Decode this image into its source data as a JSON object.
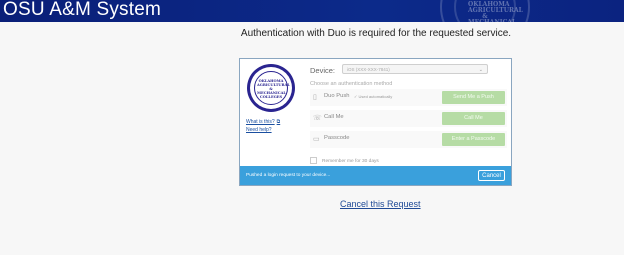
{
  "header": {
    "title": "OSU A&M System",
    "seal_text": "OKLAHOMA AGRICULTURAL & MECHANICAL COLLEGES"
  },
  "message": "Authentication with Duo is required for the requested service.",
  "duo": {
    "seal_text": "OKLAHOMA AGRICULTURAL & MECHANICAL COLLEGES",
    "what_is_this": "What is this?",
    "need_help": "Need help?",
    "device_label": "Device:",
    "device_value": "iOS (XXX-XXX-7841)",
    "choose_method": "Choose an authentication method",
    "methods": [
      {
        "label": "Duo Push",
        "extra": "✓ Used automatically",
        "button": "Send Me a Push",
        "icon": "phone-icon"
      },
      {
        "label": "Call Me",
        "extra": "",
        "button": "Call Me",
        "icon": "phone-call-icon"
      },
      {
        "label": "Passcode",
        "extra": "",
        "button": "Enter a Passcode",
        "icon": "passcode-icon"
      }
    ],
    "remember": "Remember me for 30 days",
    "status": "Pushed a login request to your device...",
    "cancel": "Cancel"
  },
  "cancel_request": "Cancel this Request",
  "colors": {
    "header": "#0c2a8a",
    "status_bar": "#3aa0dc",
    "method_button": "#b6dca5",
    "link": "#1f4a96"
  }
}
